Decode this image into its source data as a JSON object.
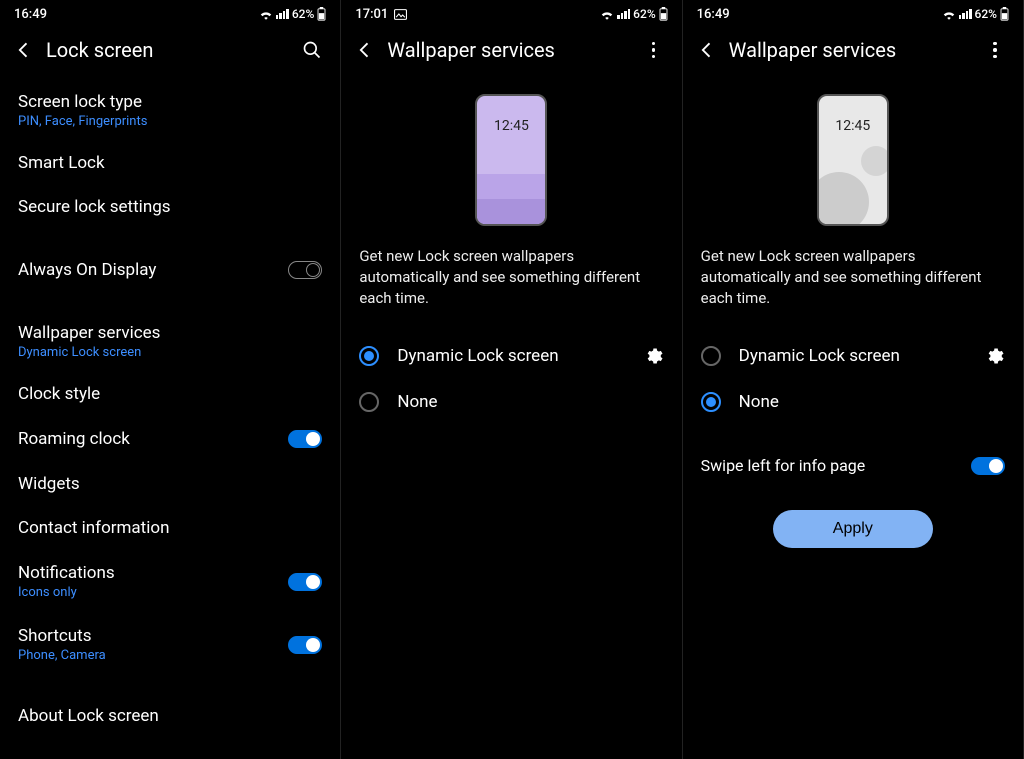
{
  "status": {
    "batt": "62%"
  },
  "preview_time": "12:45",
  "p1": {
    "time": "16:49",
    "header": "Lock screen",
    "items": {
      "screen_lock": "Screen lock type",
      "screen_lock_sub": "PIN, Face, Fingerprints",
      "smart_lock": "Smart Lock",
      "secure_lock": "Secure lock settings",
      "aod": "Always On Display",
      "wallpaper": "Wallpaper services",
      "wallpaper_sub": "Dynamic Lock screen",
      "clock_style": "Clock style",
      "roaming": "Roaming clock",
      "widgets": "Widgets",
      "contact": "Contact information",
      "notif": "Notifications",
      "notif_sub": "Icons only",
      "shortcuts": "Shortcuts",
      "shortcuts_sub": "Phone, Camera",
      "about": "About Lock screen"
    }
  },
  "p2": {
    "time": "17:01",
    "header": "Wallpaper services",
    "desc": "Get new Lock screen wallpapers automatically and see something different each time.",
    "opt_dynamic": "Dynamic Lock screen",
    "opt_none": "None"
  },
  "p3": {
    "time": "16:49",
    "header": "Wallpaper services",
    "desc": "Get new Lock screen wallpapers automatically and see something different each time.",
    "opt_dynamic": "Dynamic Lock screen",
    "opt_none": "None",
    "swipe": "Swipe left for info page",
    "apply": "Apply"
  }
}
